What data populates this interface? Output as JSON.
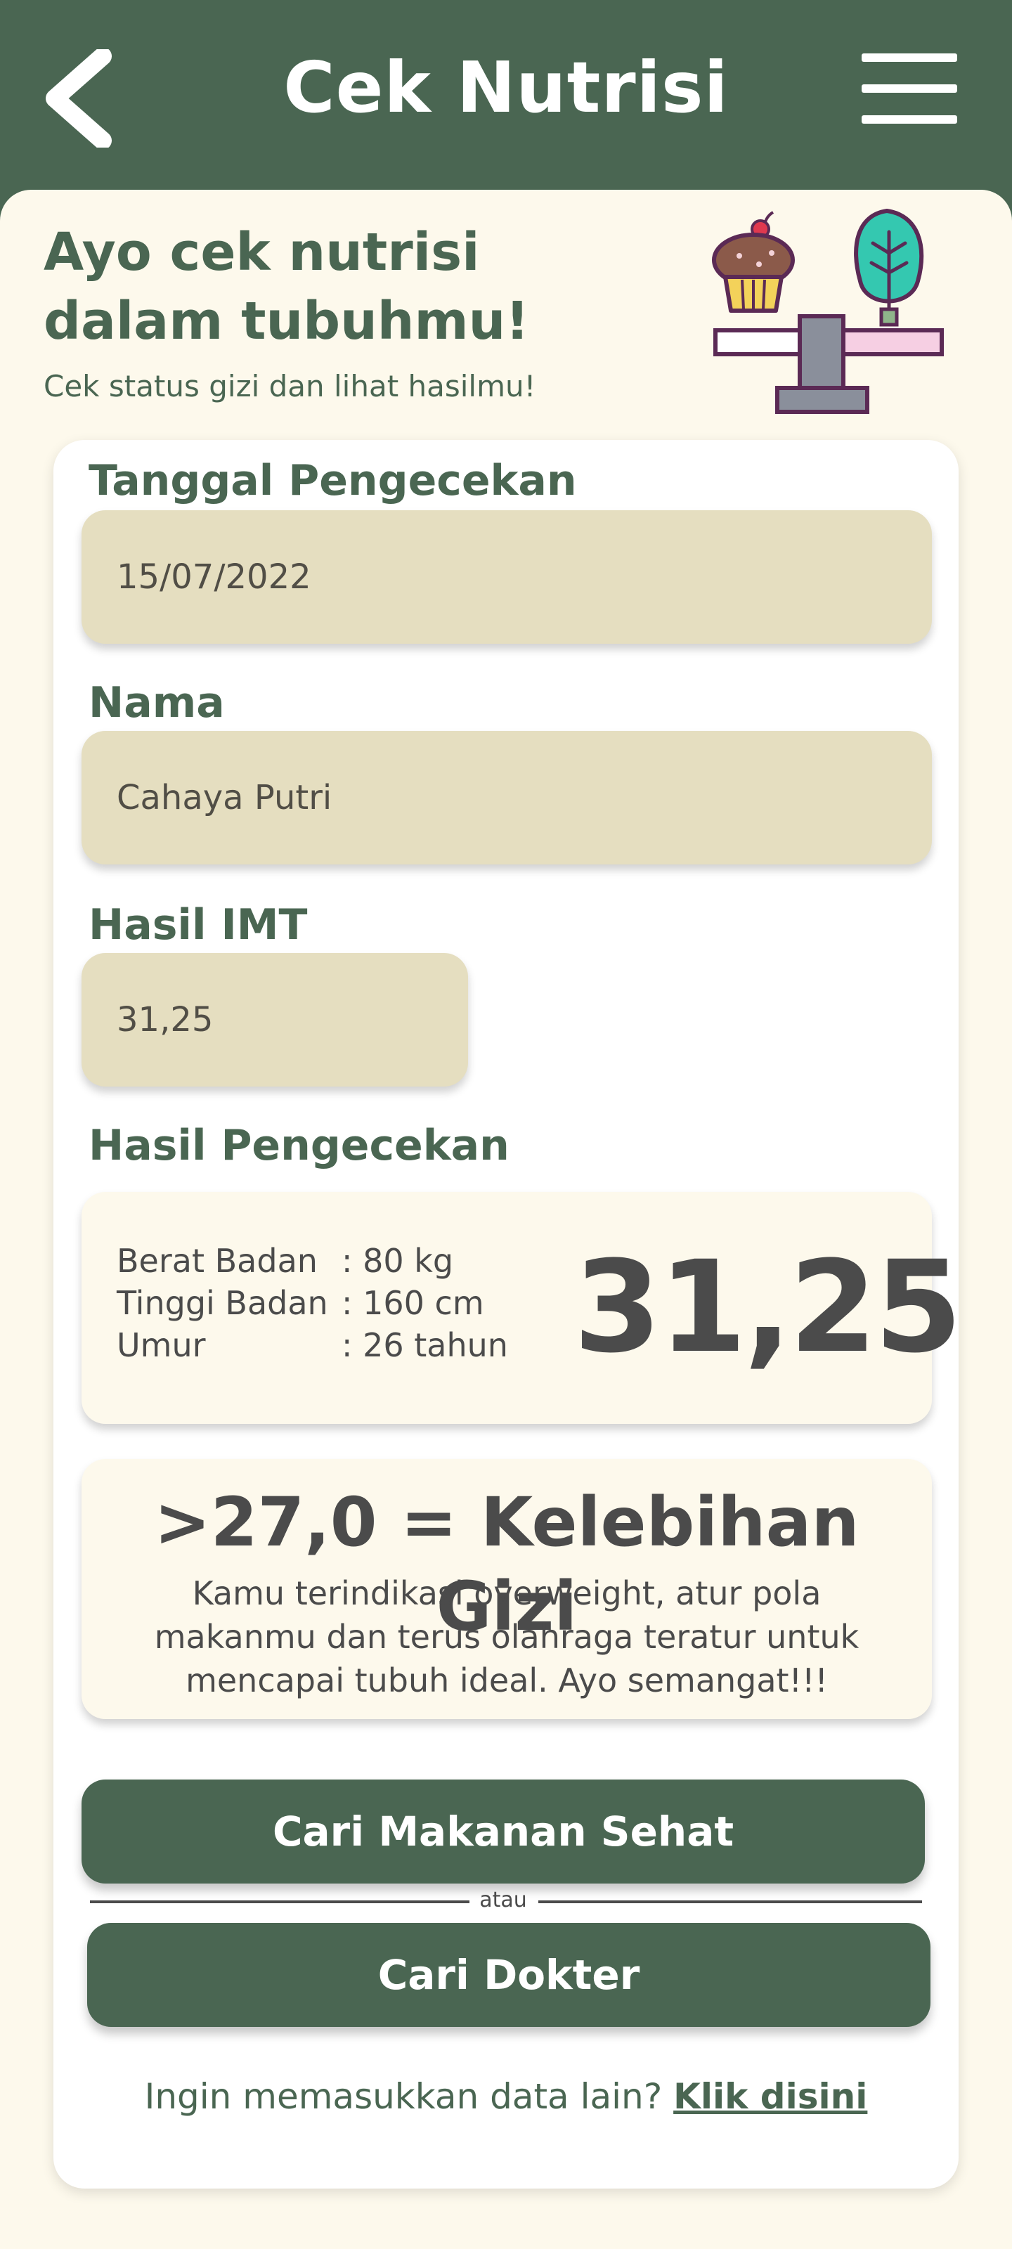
{
  "header": {
    "title": "Cek Nutrisi",
    "back_icon": "chevron-left-icon",
    "menu_icon": "hamburger-menu-icon",
    "background": "#4a6652"
  },
  "intro": {
    "headline": "Ayo cek nutrisi dalam tubuhmu!",
    "subline": "Cek status gizi dan lihat hasilmu!",
    "illustration": "food-balance-scale-illustration"
  },
  "form": {
    "date_label": "Tanggal Pengecekan",
    "date_value": "15/07/2022",
    "name_label": "Nama",
    "name_value": "Cahaya Putri",
    "imt_label": "Hasil IMT",
    "imt_value": "31,25",
    "result_label": "Hasil Pengecekan"
  },
  "result": {
    "weight_label": "Berat Badan",
    "weight_value": ": 80 kg",
    "height_label": "Tinggi Badan",
    "height_value": ": 160 cm",
    "age_label": "Umur",
    "age_value": ": 26 tahun",
    "imt_big": "31,25"
  },
  "category": {
    "title": ">27,0 = Kelebihan Gizi",
    "description": "Kamu terindikasi overweight, atur pola makanmu dan terus olahraga teratur untuk mencapai tubuh ideal. Ayo semangat!!!"
  },
  "actions": {
    "food_button": "Cari Makanan Sehat",
    "divider": "atau",
    "doctor_button": "Cari Dokter"
  },
  "footer": {
    "prompt": "Ingin memasukkan data lain? ",
    "link": "Klik disini"
  },
  "colors": {
    "primary": "#4a6652",
    "field": "#e5dec0",
    "cream": "#fdf9ec",
    "text_dark": "#4b4b4b"
  }
}
